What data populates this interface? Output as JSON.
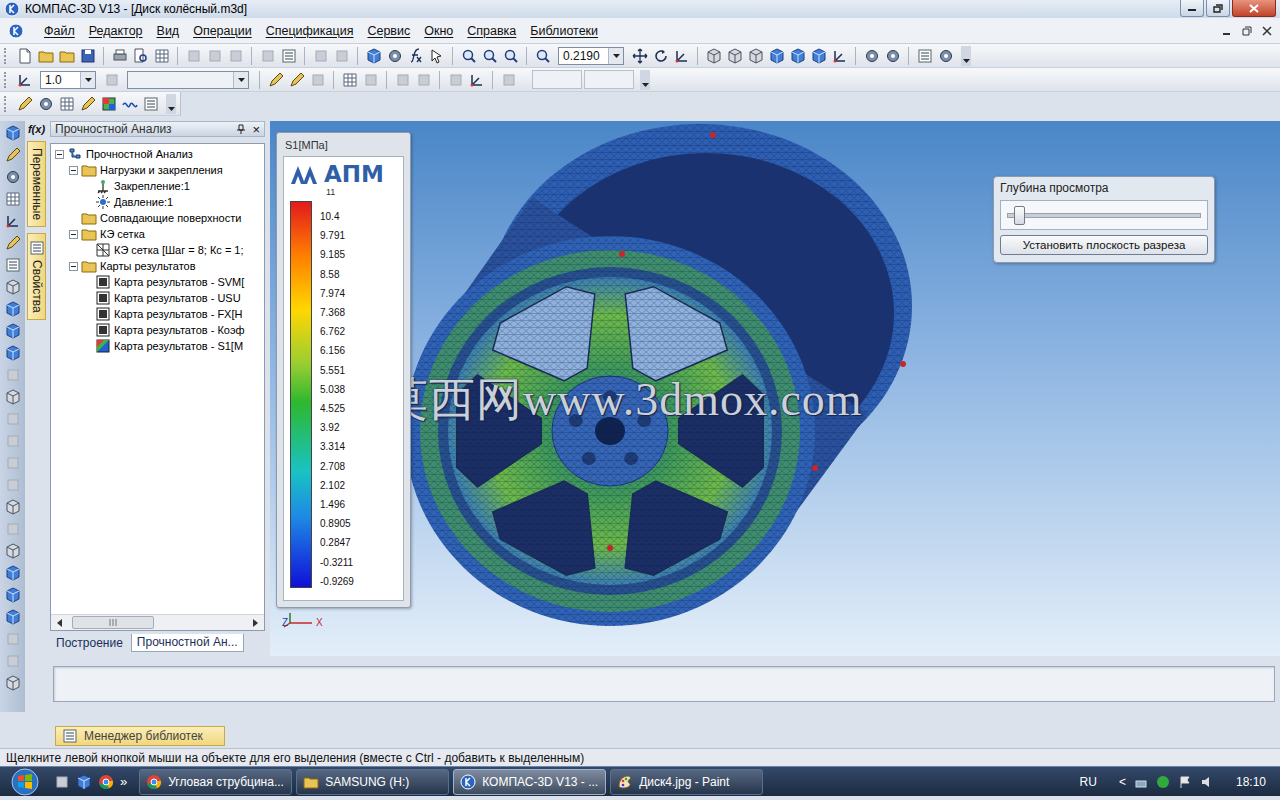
{
  "window": {
    "title": "КОМПАС-3D V13 - [Диск колёсный.m3d]"
  },
  "menu": [
    "Файл",
    "Редактор",
    "Вид",
    "Операции",
    "Спецификация",
    "Сервис",
    "Окно",
    "Справка",
    "Библиотеки"
  ],
  "toolbar": {
    "zoom": "0.2190",
    "step": "1.0"
  },
  "side_tabs": {
    "formula": "f(x)",
    "tabs": [
      {
        "label": "Переменные",
        "selected": false
      },
      {
        "label": "Свойства",
        "selected": false
      }
    ]
  },
  "tree_panel": {
    "title": "Прочностной Анализ",
    "close": "×",
    "items": [
      {
        "label": "Прочностной Анализ",
        "level": 0,
        "kind": "root",
        "toggle": true,
        "expanded": true
      },
      {
        "label": "Нагрузки и закрепления",
        "level": 1,
        "kind": "folder",
        "toggle": true,
        "expanded": true
      },
      {
        "label": "Закрепление:1",
        "level": 2,
        "kind": "fix",
        "toggle": false,
        "expanded": false
      },
      {
        "label": "Давление:1",
        "level": 2,
        "kind": "load",
        "toggle": false,
        "expanded": false
      },
      {
        "label": "Совпадающие поверхности",
        "level": 1,
        "kind": "folder",
        "toggle": false,
        "expanded": false
      },
      {
        "label": "КЭ сетка",
        "level": 1,
        "kind": "folder",
        "toggle": true,
        "expanded": true
      },
      {
        "label": "КЭ сетка [Шаг = 8; Кс = 1;",
        "level": 2,
        "kind": "mesh",
        "toggle": false,
        "expanded": false
      },
      {
        "label": "Карты результатов",
        "level": 1,
        "kind": "folder",
        "toggle": true,
        "expanded": true
      },
      {
        "label": "Карта результатов - SVM[",
        "level": 2,
        "kind": "map",
        "toggle": false,
        "expanded": false
      },
      {
        "label": "Карта результатов - USU",
        "level": 2,
        "kind": "map",
        "toggle": false,
        "expanded": false
      },
      {
        "label": "Карта результатов - FX[Н",
        "level": 2,
        "kind": "map",
        "toggle": false,
        "expanded": false
      },
      {
        "label": "Карта результатов - Коэф",
        "level": 2,
        "kind": "map",
        "toggle": false,
        "expanded": false
      },
      {
        "label": "Карта результатов - S1[М",
        "level": 2,
        "kind": "mapcolor",
        "toggle": false,
        "expanded": false
      }
    ],
    "tabs": [
      {
        "label": "Построение",
        "selected": false
      },
      {
        "label": "Прочностной Ан...",
        "selected": true
      }
    ]
  },
  "legend": {
    "title": "S1[МПа]",
    "logo": "АПМ",
    "count": "11",
    "values": [
      "10.4",
      "9.791",
      "9.185",
      "8.58",
      "7.974",
      "7.368",
      "6.762",
      "6.156",
      "5.551",
      "5.038",
      "4.525",
      "3.92",
      "3.314",
      "2.708",
      "2.102",
      "1.496",
      "0.8905",
      "0.2847",
      "-0.3211",
      "-0.9269"
    ]
  },
  "viewport": {
    "watermark": "莫西网www.3dmox.com",
    "axes": [
      "Z",
      "X"
    ]
  },
  "depth_panel": {
    "title": "Глубина просмотра",
    "level": 0.03,
    "button": "Установить плоскость разреза"
  },
  "library_tab": "Менеджер библиотек",
  "status_bar": "Щелкните левой кнопкой мыши на объекте для его выделения (вместе с Ctrl - добавить к выделенным)",
  "taskbar": {
    "more": "»",
    "tasks": [
      {
        "label": "Угловая струбцина...",
        "kind": "chrome",
        "selected": false
      },
      {
        "label": "SAMSUNG (H:)",
        "kind": "folder",
        "selected": false
      },
      {
        "label": "КОМПАС-3D V13 - ...",
        "kind": "kompas",
        "selected": true
      },
      {
        "label": "Диск4.jpg - Paint",
        "kind": "paint",
        "selected": false
      }
    ],
    "language": "RU",
    "tray_more": "<",
    "time": "18:10"
  }
}
